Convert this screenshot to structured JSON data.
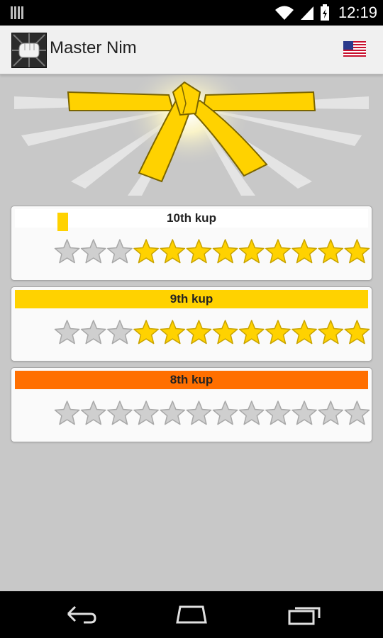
{
  "status_bar": {
    "time": "12:19",
    "icons": [
      "notification-icon",
      "wifi-icon",
      "signal-icon",
      "battery-icon"
    ]
  },
  "app": {
    "title": "Master Nim",
    "logo_icon": "fist-icon",
    "language_icon": "us-flag-icon"
  },
  "hero": {
    "image": "yellow-belt",
    "belt_color": "#ffd700"
  },
  "levels": [
    {
      "label": "10th kup",
      "bar_color": "#ffffff",
      "progress_percent": 3,
      "progress_color": "#ffd200",
      "total_stars": 12,
      "earned_stars": 9
    },
    {
      "label": "9th kup",
      "bar_color": "#ffd200",
      "total_stars": 12,
      "earned_stars": 9
    },
    {
      "label": "8th kup",
      "bar_color": "#ff6f00",
      "total_stars": 12,
      "earned_stars": 0
    }
  ],
  "colors": {
    "star_gold": "#ffd200",
    "star_gray": "#cfcfcf"
  },
  "nav": {
    "icons": [
      "back-icon",
      "home-icon",
      "recent-apps-icon"
    ]
  }
}
